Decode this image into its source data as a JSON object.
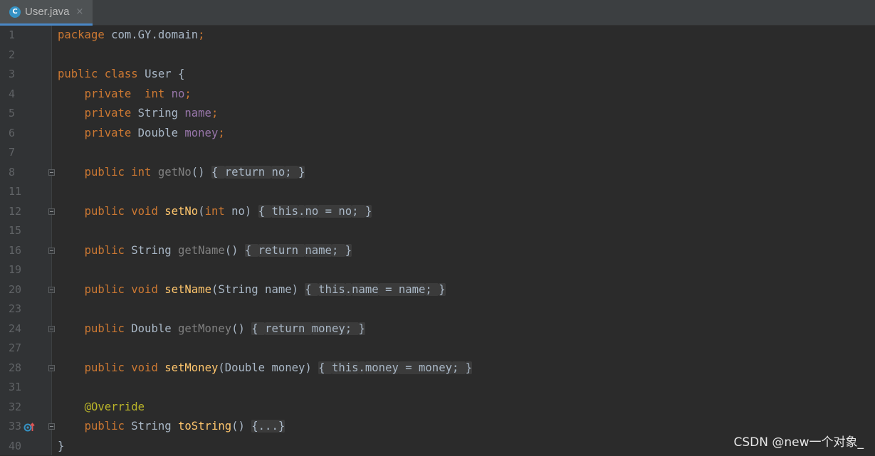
{
  "tab": {
    "icon": "C",
    "label": "User.java",
    "close": "×"
  },
  "lines": [
    {
      "n": "1",
      "tokens": [
        [
          "kw",
          "package "
        ],
        [
          "cls",
          "com.GY.domain"
        ],
        [
          "kw",
          ";"
        ]
      ]
    },
    {
      "n": "2",
      "tokens": []
    },
    {
      "n": "3",
      "tokens": [
        [
          "kw",
          "public class "
        ],
        [
          "cls",
          "User {"
        ]
      ]
    },
    {
      "n": "4",
      "tokens": [
        [
          "",
          "    "
        ],
        [
          "kw",
          "private  int "
        ],
        [
          "fld",
          "no"
        ],
        [
          "kw",
          ";"
        ]
      ]
    },
    {
      "n": "5",
      "tokens": [
        [
          "",
          "    "
        ],
        [
          "kw",
          "private "
        ],
        [
          "cls",
          "String "
        ],
        [
          "fld",
          "name"
        ],
        [
          "kw",
          ";"
        ]
      ]
    },
    {
      "n": "6",
      "tokens": [
        [
          "",
          "    "
        ],
        [
          "kw",
          "private "
        ],
        [
          "cls",
          "Double "
        ],
        [
          "fld",
          "money"
        ],
        [
          "kw",
          ";"
        ]
      ]
    },
    {
      "n": "7",
      "tokens": []
    },
    {
      "n": "8",
      "fold": true,
      "tokens": [
        [
          "",
          "    "
        ],
        [
          "kw",
          "public int "
        ],
        [
          "gray",
          "getNo"
        ],
        [
          "cls",
          "() "
        ],
        [
          "fb",
          "{ "
        ],
        [
          "fbkw",
          "return "
        ],
        [
          "fbfld",
          "no"
        ],
        [
          "fbkw",
          "; "
        ],
        [
          "fb",
          "}"
        ]
      ]
    },
    {
      "n": "11",
      "tokens": []
    },
    {
      "n": "12",
      "fold": true,
      "tokens": [
        [
          "",
          "    "
        ],
        [
          "kw",
          "public void "
        ],
        [
          "fn",
          "setNo"
        ],
        [
          "cls",
          "("
        ],
        [
          "kw",
          "int "
        ],
        [
          "cls",
          "no) "
        ],
        [
          "fb",
          "{ "
        ],
        [
          "fbkw",
          "this"
        ],
        [
          "fb",
          "."
        ],
        [
          "fbfld",
          "no"
        ],
        [
          "fb",
          " = no"
        ],
        [
          "fbkw",
          "; "
        ],
        [
          "fb",
          "}"
        ]
      ]
    },
    {
      "n": "15",
      "tokens": []
    },
    {
      "n": "16",
      "fold": true,
      "tokens": [
        [
          "",
          "    "
        ],
        [
          "kw",
          "public "
        ],
        [
          "cls",
          "String "
        ],
        [
          "gray",
          "getName"
        ],
        [
          "cls",
          "() "
        ],
        [
          "fb",
          "{ "
        ],
        [
          "fbkw",
          "return "
        ],
        [
          "fbfld",
          "name"
        ],
        [
          "fbkw",
          "; "
        ],
        [
          "fb",
          "}"
        ]
      ]
    },
    {
      "n": "19",
      "tokens": []
    },
    {
      "n": "20",
      "fold": true,
      "tokens": [
        [
          "",
          "    "
        ],
        [
          "kw",
          "public void "
        ],
        [
          "fn",
          "setName"
        ],
        [
          "cls",
          "(String name) "
        ],
        [
          "fb",
          "{ "
        ],
        [
          "fbkw",
          "this"
        ],
        [
          "fb",
          "."
        ],
        [
          "fbfld",
          "name"
        ],
        [
          "fb",
          " = name"
        ],
        [
          "fbkw",
          "; "
        ],
        [
          "fb",
          "}"
        ]
      ]
    },
    {
      "n": "23",
      "tokens": []
    },
    {
      "n": "24",
      "fold": true,
      "tokens": [
        [
          "",
          "    "
        ],
        [
          "kw",
          "public "
        ],
        [
          "cls",
          "Double "
        ],
        [
          "gray",
          "getMoney"
        ],
        [
          "cls",
          "() "
        ],
        [
          "fb",
          "{ "
        ],
        [
          "fbkw",
          "return "
        ],
        [
          "fbfld",
          "money"
        ],
        [
          "fbkw",
          "; "
        ],
        [
          "fb",
          "}"
        ]
      ]
    },
    {
      "n": "27",
      "tokens": []
    },
    {
      "n": "28",
      "fold": true,
      "tokens": [
        [
          "",
          "    "
        ],
        [
          "kw",
          "public void "
        ],
        [
          "fn",
          "setMoney"
        ],
        [
          "cls",
          "(Double money) "
        ],
        [
          "fb",
          "{ "
        ],
        [
          "fbkw",
          "this"
        ],
        [
          "fb",
          "."
        ],
        [
          "fbfld",
          "money"
        ],
        [
          "fb",
          " = money"
        ],
        [
          "fbkw",
          "; "
        ],
        [
          "fb",
          "}"
        ]
      ]
    },
    {
      "n": "31",
      "tokens": []
    },
    {
      "n": "32",
      "tokens": [
        [
          "",
          "    "
        ],
        [
          "ann",
          "@Override"
        ]
      ]
    },
    {
      "n": "33",
      "fold": true,
      "marker": "override-marker-icon",
      "tokens": [
        [
          "",
          "    "
        ],
        [
          "kw",
          "public "
        ],
        [
          "cls",
          "String "
        ],
        [
          "fn",
          "toString"
        ],
        [
          "cls",
          "() "
        ],
        [
          "fb",
          "{...}"
        ]
      ]
    },
    {
      "n": "40",
      "tokens": [
        [
          "cls",
          "}"
        ]
      ]
    }
  ],
  "watermark": "CSDN @new一个对象_",
  "colors": {
    "background": "#2b2b2b",
    "gutter": "#313335",
    "keyword": "#cc7832",
    "field": "#9876aa",
    "method": "#ffc66d",
    "annotation": "#bbb529",
    "text": "#a9b7c6",
    "tab_underline": "#4a88c7"
  }
}
